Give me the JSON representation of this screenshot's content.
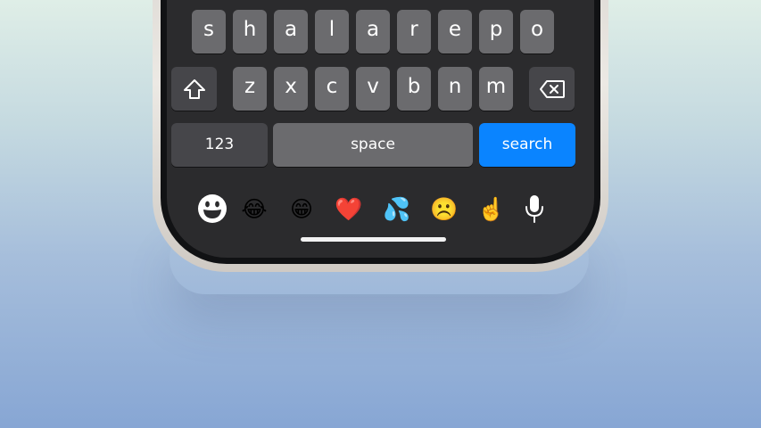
{
  "keyboard": {
    "row1": [
      "s",
      "h",
      "a",
      "l",
      "a",
      "r",
      "e",
      "p",
      "o"
    ],
    "row2": [
      "z",
      "x",
      "c",
      "v",
      "b",
      "n",
      "m"
    ],
    "numbers_label": "123",
    "space_label": "space",
    "return_label": "search",
    "return_color": "#0a84ff"
  },
  "emoji_bar": {
    "emojis": [
      "😂",
      "😁",
      "❤️",
      "💦",
      "☹️",
      "☝️"
    ],
    "keyboard_switch_icon": "emoji-face-icon",
    "dictation_icon": "microphone-icon"
  }
}
